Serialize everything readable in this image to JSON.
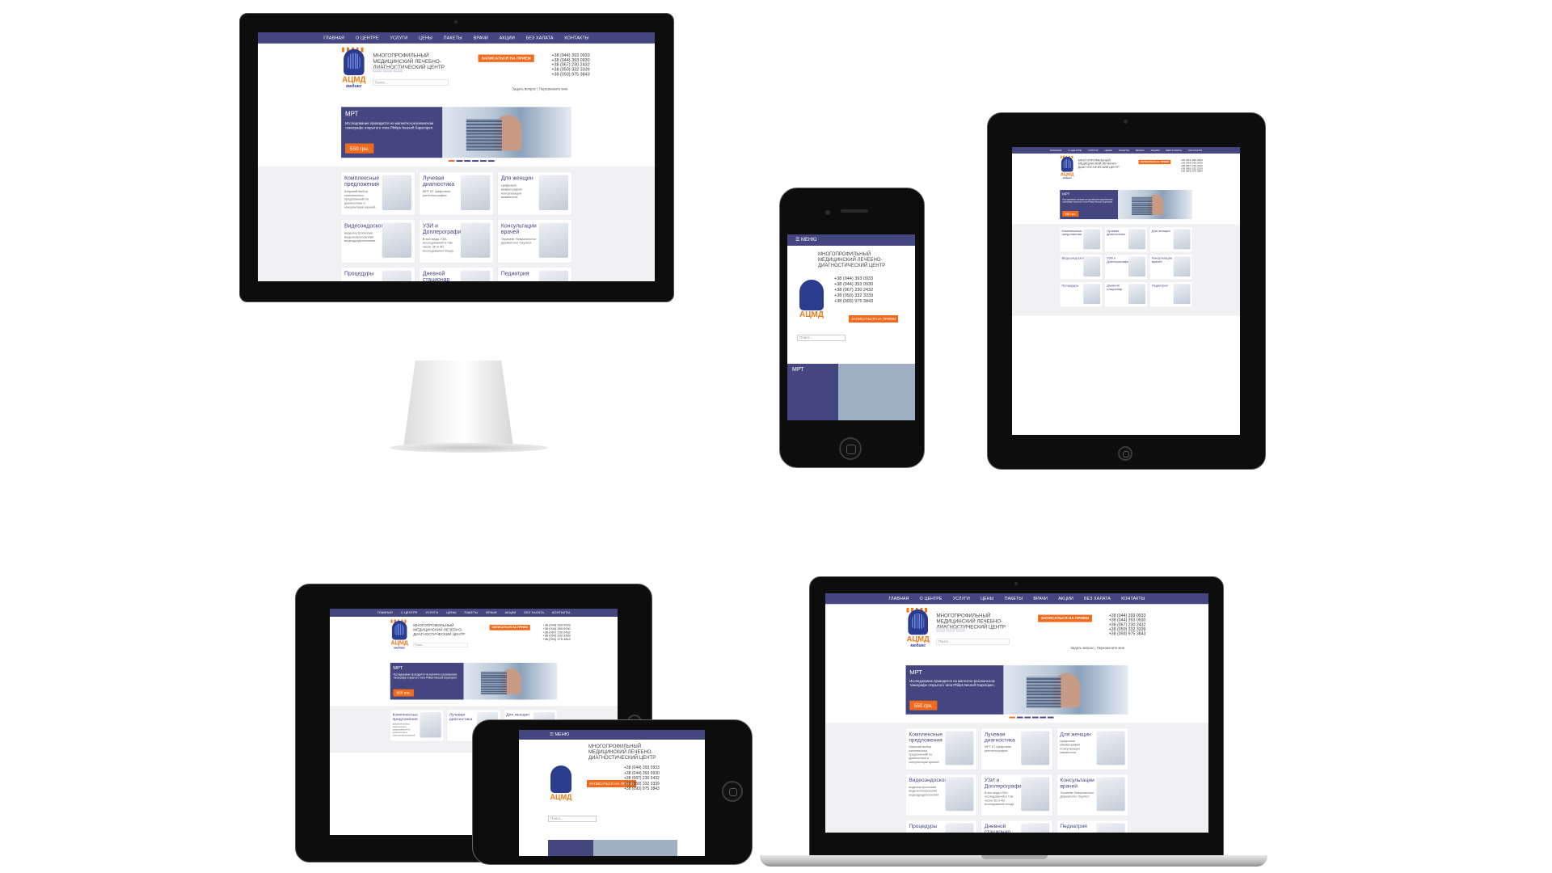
{
  "site": {
    "nav": [
      "ГЛАВНАЯ",
      "О ЦЕНТРЕ",
      "УСЛУГИ",
      "ЦЕНЫ",
      "ПАКЕТЫ",
      "ВРАЧИ",
      "АКЦИИ",
      "БЕЗ ХАЛАТА",
      "КОНТАКТЫ"
    ],
    "logo_abbr": "АЦМД",
    "logo_sub": "медикс",
    "title": "МНОГОПРОФИЛЬНЫЙ МЕДИЦИНСКИЙ ЛЕЧЕБНО-ДИАГНОСТИЧЕСКИЙ ЦЕНТР",
    "cta": "ЗАПИСАТЬСЯ НА ПРИЕМ",
    "phones": [
      "+38 (044) 393 0933",
      "+38 (044) 393 0930",
      "+38 (067) 230 2432",
      "+38 (050) 332 3339",
      "+38 (093) 975 3843"
    ],
    "search_placeholder": "Поиск...",
    "ask": "Задать вопрос",
    "callback": "Перезвоните мне",
    "find_us": "КАК НАС НАЙТИ",
    "menu": "МЕНЮ",
    "hero": {
      "title": "МРТ",
      "desc": "Исследование проводится на магнитно-резонансном томографе открытого типа Philips Neusoft Superopen.",
      "price": "550 грн."
    },
    "cards": [
      {
        "title": "Комплексные предложения",
        "desc": "Широкий выбор комплексных предложений по диагностике и консультации врачей"
      },
      {
        "title": "Лучевая диагностика",
        "desc": "МРТ КТ Цифровая рентгенография"
      },
      {
        "title": "Для женщин",
        "desc": "Цифровая маммография Консультации маммолога"
      },
      {
        "title": "Видеоэндоскопия",
        "desc": "видеогастроскопия видеоколоноскопия видеодуоденоскопия"
      },
      {
        "title": "УЗИ и Доплерография",
        "desc": "В все виды УЗИ-исследований в том числе 3D и 4D исследования плода"
      },
      {
        "title": "Консультации врачей",
        "desc": "Терапевт Невропатолог Дерматолог Окулист"
      },
      {
        "title": "Процедуры",
        "desc": ""
      },
      {
        "title": "Дневной стационар",
        "desc": ""
      },
      {
        "title": "Педиатрия",
        "desc": ""
      }
    ]
  },
  "colors": {
    "nav_bg": "#43467f",
    "accent": "#f06b1d",
    "bezel": "#0d0d0d"
  }
}
